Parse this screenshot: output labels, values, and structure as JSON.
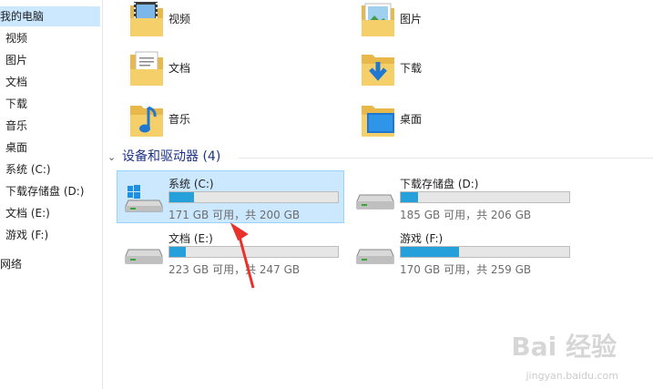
{
  "sidebar": {
    "items": [
      {
        "label": "我的电脑",
        "selected": true
      },
      {
        "label": "视频"
      },
      {
        "label": "图片"
      },
      {
        "label": "文档"
      },
      {
        "label": "下载"
      },
      {
        "label": "音乐"
      },
      {
        "label": "桌面"
      },
      {
        "label": "系统 (C:)"
      },
      {
        "label": "下载存储盘 (D:)"
      },
      {
        "label": "文档 (E:)"
      },
      {
        "label": "游戏 (F:)"
      },
      {
        "label": "网络"
      }
    ]
  },
  "folders": [
    {
      "label": "视频",
      "icon": "video-folder-icon"
    },
    {
      "label": "图片",
      "icon": "pictures-folder-icon"
    },
    {
      "label": "文档",
      "icon": "documents-folder-icon"
    },
    {
      "label": "下载",
      "icon": "downloads-folder-icon"
    },
    {
      "label": "音乐",
      "icon": "music-folder-icon"
    },
    {
      "label": "桌面",
      "icon": "desktop-folder-icon"
    }
  ],
  "devices_section": {
    "title": "设备和驱动器 (4)"
  },
  "drives": [
    {
      "name": "系统 (C:)",
      "free": "171 GB 可用，共 200 GB",
      "used_fraction": 0.145,
      "selected": true,
      "icon": "windows-drive-icon"
    },
    {
      "name": "下载存储盘 (D:)",
      "free": "185 GB 可用，共 206 GB",
      "used_fraction": 0.102,
      "icon": "hard-drive-icon"
    },
    {
      "name": "文档 (E:)",
      "free": "223 GB 可用，共 247 GB",
      "used_fraction": 0.097,
      "icon": "hard-drive-icon"
    },
    {
      "name": "游戏 (F:)",
      "free": "170 GB 可用，共 259 GB",
      "used_fraction": 0.344,
      "icon": "hard-drive-icon"
    }
  ],
  "colors": {
    "accent": "#26a0da",
    "selection": "#cce8ff",
    "section_title": "#1e3287",
    "arrow": "#e8322b"
  },
  "watermark": {
    "brand": "Bai 经验",
    "url": "jingyan.baidu.com"
  }
}
